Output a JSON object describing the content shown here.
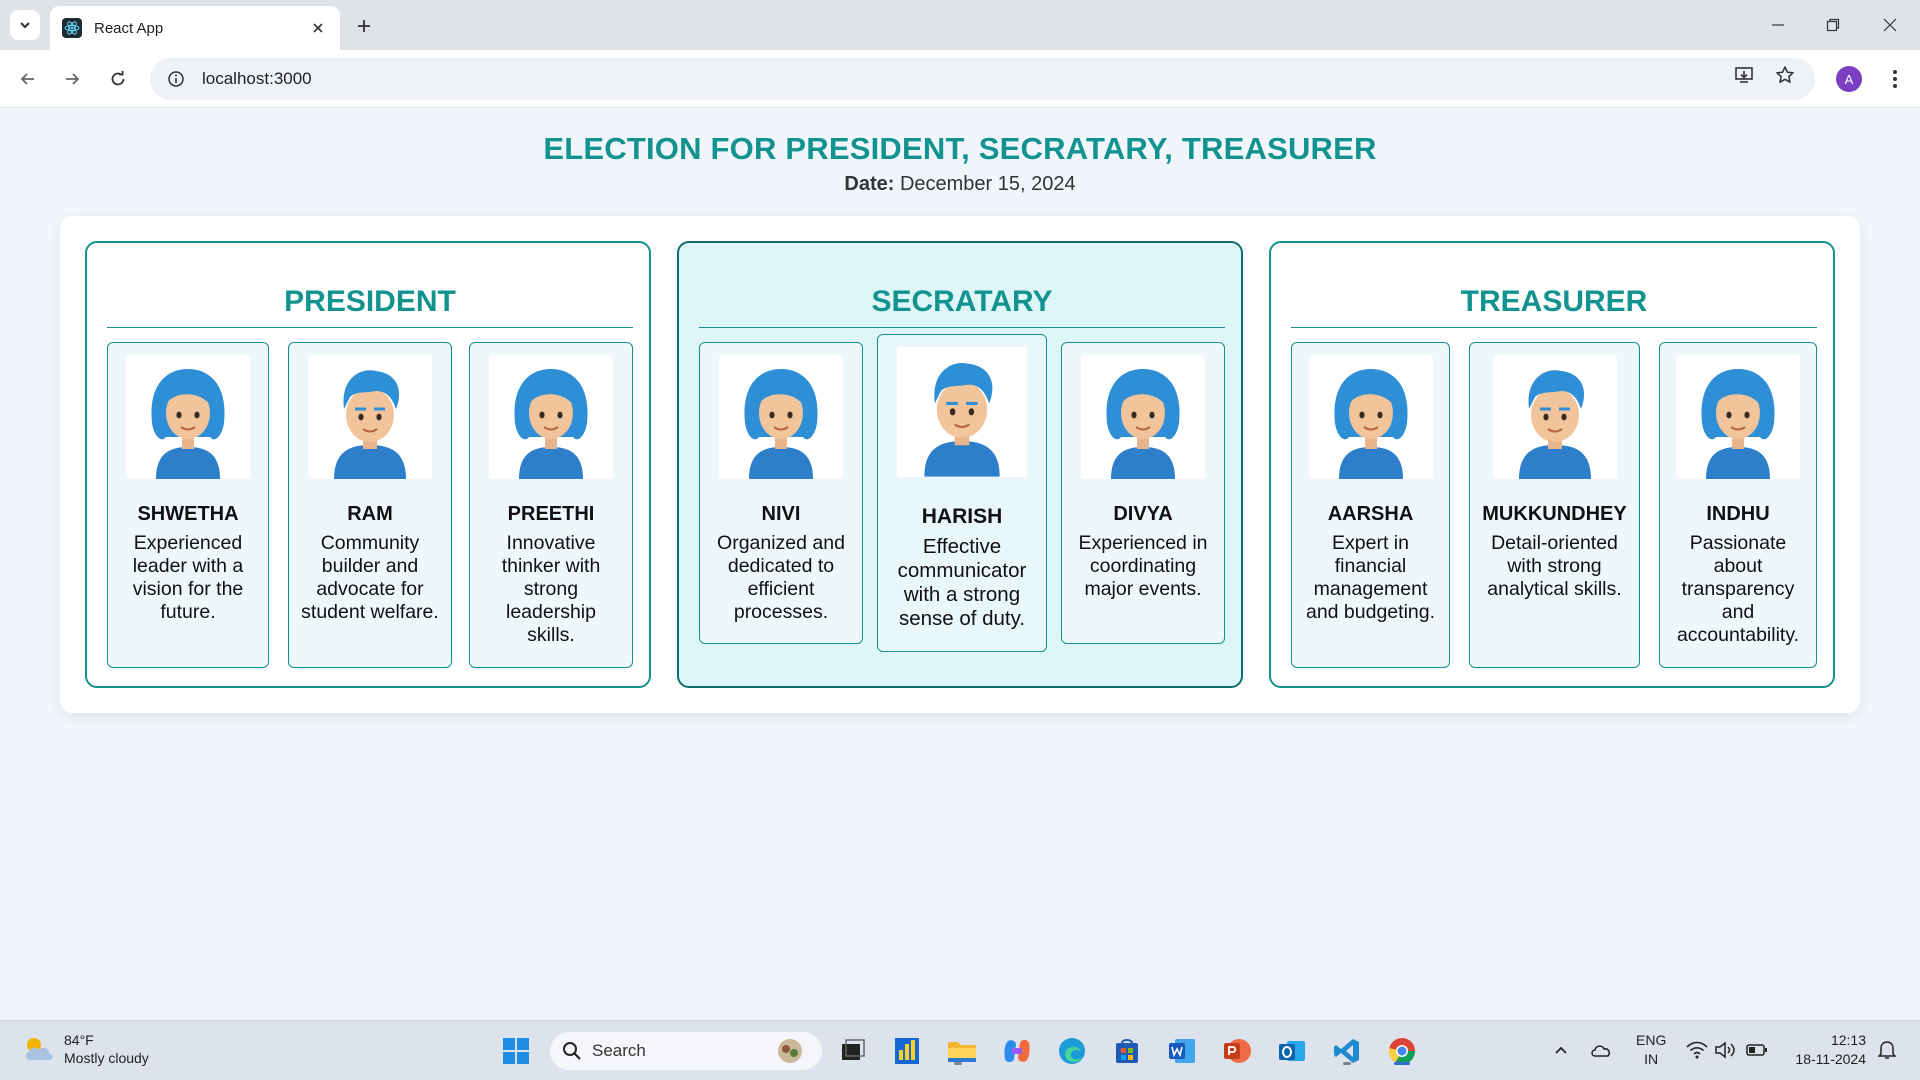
{
  "browser": {
    "tab_title": "React App",
    "url": "localhost:3000",
    "profile_initial": "A"
  },
  "page": {
    "title": "ELECTION FOR PRESIDENT, SECRATARY, TREASURER",
    "date_label": "Date:",
    "date_value": "December 15, 2024"
  },
  "positions": [
    {
      "title": "PRESIDENT",
      "candidates": [
        {
          "name": "SHWETHA",
          "desc": "Experienced leader with a vision for the future.",
          "avatar": "woman-avatar-icon"
        },
        {
          "name": "RAM",
          "desc": "Community builder and advocate for student welfare.",
          "avatar": "man-avatar-icon"
        },
        {
          "name": "PREETHI",
          "desc": "Innovative thinker with strong leadership skills.",
          "avatar": "woman-avatar-icon"
        }
      ]
    },
    {
      "title": "SECRATARY",
      "candidates": [
        {
          "name": "NIVI",
          "desc": "Organized and dedicated to efficient processes.",
          "avatar": "woman-avatar-icon"
        },
        {
          "name": "HARISH",
          "desc": "Effective communicator with a strong sense of duty.",
          "avatar": "man-avatar-icon"
        },
        {
          "name": "DIVYA",
          "desc": "Experienced in coordinating major events.",
          "avatar": "woman-avatar-icon"
        }
      ]
    },
    {
      "title": "TREASURER",
      "candidates": [
        {
          "name": "AARSHA",
          "desc": "Expert in financial management and budgeting.",
          "avatar": "woman-avatar-icon"
        },
        {
          "name": "MUKKUNDHEY",
          "desc": "Detail-oriented with strong analytical skills.",
          "avatar": "man-avatar-icon"
        },
        {
          "name": "INDHU",
          "desc": "Passionate about transparency and accountability.",
          "avatar": "woman-avatar-icon"
        }
      ]
    }
  ],
  "taskbar": {
    "weather_temp": "84°F",
    "weather_desc": "Mostly cloudy",
    "search_label": "Search",
    "lang_line1": "ENG",
    "lang_line2": "IN",
    "time": "12:13",
    "date": "18-11-2024"
  },
  "colors": {
    "accent": "#13938f",
    "card_active_bg": "#dff6f8",
    "avatar_hair": "#2f8fd6",
    "avatar_shirt": "#2d7fc9"
  }
}
